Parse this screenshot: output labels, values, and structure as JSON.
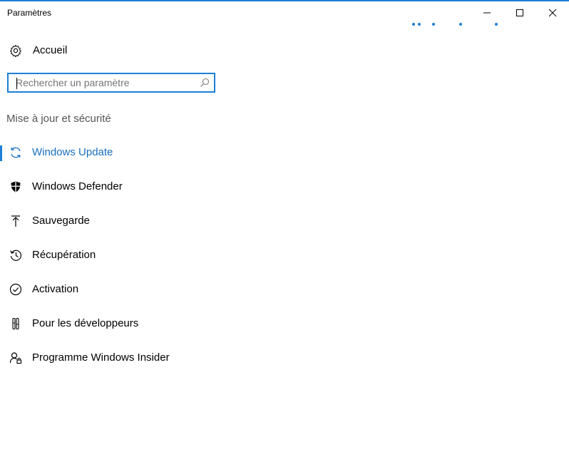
{
  "window": {
    "title": "Paramètres",
    "controls": [
      "minimize",
      "maximize",
      "close"
    ],
    "accent_color": "#1e7fd6"
  },
  "home": {
    "label": "Accueil",
    "icon": "gear-icon"
  },
  "search": {
    "placeholder": "Rechercher un paramètre",
    "value": "",
    "icon": "search-icon"
  },
  "section": {
    "title": "Mise à jour et sécurité"
  },
  "nav": {
    "items": [
      {
        "label": "Windows Update",
        "icon": "refresh-icon",
        "active": true
      },
      {
        "label": "Windows Defender",
        "icon": "shield-icon",
        "active": false
      },
      {
        "label": "Sauvegarde",
        "icon": "upload-arrow-icon",
        "active": false
      },
      {
        "label": "Récupération",
        "icon": "history-icon",
        "active": false
      },
      {
        "label": "Activation",
        "icon": "check-circle-icon",
        "active": false
      },
      {
        "label": "Pour les développeurs",
        "icon": "developer-tools-icon",
        "active": false
      },
      {
        "label": "Programme Windows Insider",
        "icon": "insider-person-icon",
        "active": false
      }
    ]
  }
}
